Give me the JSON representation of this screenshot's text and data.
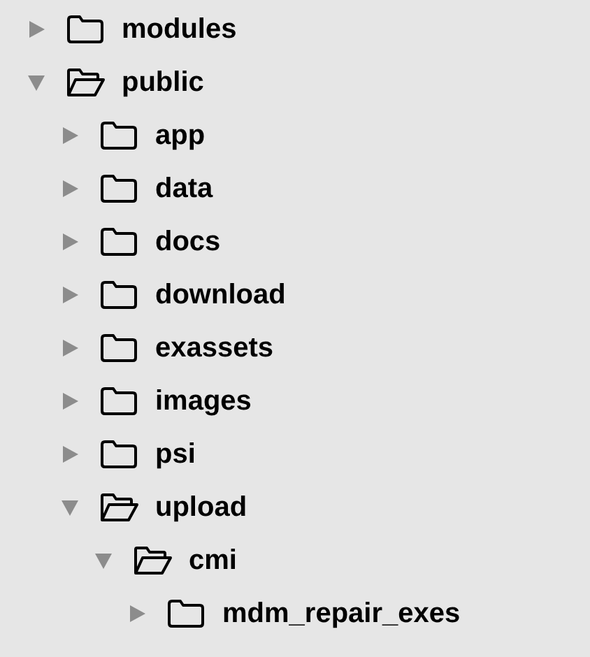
{
  "tree": [
    {
      "name": "modules",
      "expanded": false
    },
    {
      "name": "public",
      "expanded": true,
      "children": [
        {
          "name": "app",
          "expanded": false
        },
        {
          "name": "data",
          "expanded": false
        },
        {
          "name": "docs",
          "expanded": false
        },
        {
          "name": "download",
          "expanded": false
        },
        {
          "name": "exassets",
          "expanded": false
        },
        {
          "name": "images",
          "expanded": false
        },
        {
          "name": "psi",
          "expanded": false
        },
        {
          "name": "upload",
          "expanded": true,
          "children": [
            {
              "name": "cmi",
              "expanded": true,
              "children": [
                {
                  "name": "mdm_repair_exes",
                  "expanded": false
                }
              ]
            }
          ]
        }
      ]
    }
  ]
}
